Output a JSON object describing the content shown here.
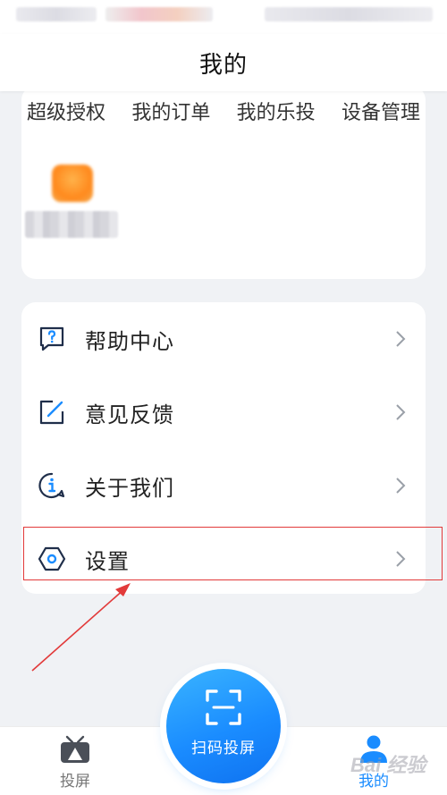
{
  "header": {
    "title": "我的"
  },
  "quick_links": [
    "超级授权",
    "我的订单",
    "我的乐投",
    "设备管理"
  ],
  "menu": {
    "items": [
      {
        "label": "帮助中心",
        "icon": "help-icon"
      },
      {
        "label": "意见反馈",
        "icon": "feedback-icon"
      },
      {
        "label": "关于我们",
        "icon": "info-icon"
      },
      {
        "label": "设置",
        "icon": "settings-icon"
      }
    ]
  },
  "tabs": {
    "cast": "投屏",
    "scan": "扫码投屏",
    "mine": "我的"
  },
  "watermark": "Bai 经验",
  "colors": {
    "accent": "#1a8cff",
    "icon": "#1f2e4a",
    "highlight": "#e23a3a"
  }
}
